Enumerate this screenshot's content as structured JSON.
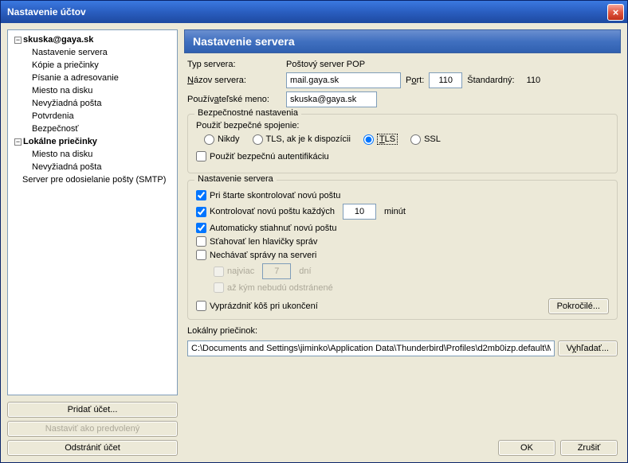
{
  "titlebar": {
    "text": "Nastavenie účtov"
  },
  "tree": {
    "account": "skuska@gaya.sk",
    "acct_children": [
      "Nastavenie servera",
      "Kópie a priečinky",
      "Písanie a adresovanie",
      "Miesto na disku",
      "Nevyžiadná pošta",
      "Potvrdenia",
      "Bezpečnosť"
    ],
    "local": "Lokálne priečinky",
    "local_children": [
      "Miesto na disku",
      "Nevyžiadná pošta"
    ],
    "smtp": "Server pre odosielanie pošty (SMTP)"
  },
  "left_buttons": {
    "add": "Pridať účet...",
    "setdefault": "Nastaviť ako predvolený",
    "remove": "Odstrániť účet"
  },
  "header": "Nastavenie servera",
  "form": {
    "type_label": "Typ servera:",
    "type_value": "Poštový server POP",
    "name_label": "Názov servera:",
    "name_value": "mail.gaya.sk",
    "port_label": "Port:",
    "port_value": "110",
    "std_label": "Štandardný:",
    "std_value": "110",
    "user_label": "Používateľské meno:",
    "user_value": "skuska@gaya.sk"
  },
  "security": {
    "legend": "Bezpečnostné nastavenia",
    "conn_label": "Použiť bezpečné spojenie:",
    "r_never": "Nikdy",
    "r_tlsif": "TLS, ak je k dispozícii",
    "r_tls": "TLS",
    "r_ssl": "SSL",
    "secure_auth": "Použiť bezpečnú autentifikáciu"
  },
  "server": {
    "legend": "Nastavenie servera",
    "chk_start": "Pri štarte skontrolovať novú poštu",
    "chk_every": "Kontrolovať novú poštu každých",
    "every_value": "10",
    "every_unit": "minút",
    "chk_auto": "Automaticky stiahnuť novú poštu",
    "chk_headers": "Sťahovať len hlavičky správ",
    "chk_leave": "Nechávať správy na serveri",
    "chk_max": "najviac",
    "max_value": "7",
    "max_unit": "dní",
    "chk_until": "až kým nebudú odstránené",
    "empty_trash": "Vyprázdniť kôš pri ukončení",
    "advanced": "Pokročilé..."
  },
  "local": {
    "label": "Lokálny priečinok:",
    "value": "C:\\Documents and Settings\\jiminko\\Application Data\\Thunderbird\\Profiles\\d2mb0izp.default\\M",
    "browse": "Vyhľadať..."
  },
  "dialog": {
    "ok": "OK",
    "cancel": "Zrušiť"
  }
}
